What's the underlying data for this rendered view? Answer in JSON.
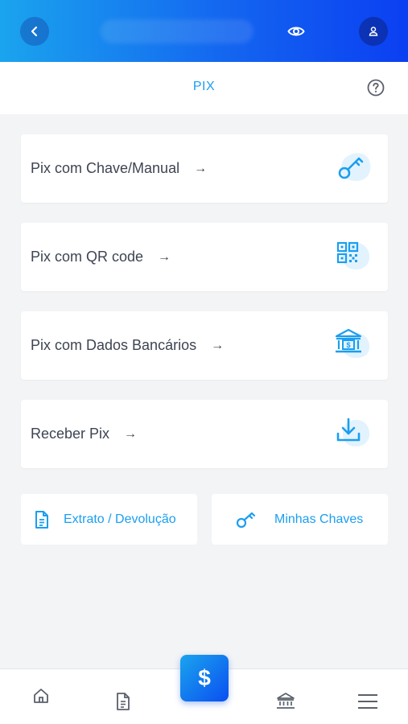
{
  "header": {
    "title": "PIX"
  },
  "cards": [
    {
      "label": "Pix com Chave/Manual",
      "arrow": "→",
      "icon": "key-icon"
    },
    {
      "label": "Pix com QR code",
      "arrow": "→",
      "icon": "qr-code-icon"
    },
    {
      "label": "Pix com Dados Bancários",
      "arrow": "→",
      "icon": "bank-icon"
    },
    {
      "label": "Receber Pix",
      "arrow": "→",
      "icon": "download-icon"
    }
  ],
  "quick": [
    {
      "label": "Extrato / Devolução",
      "icon": "document-icon"
    },
    {
      "label": "Minhas Chaves",
      "icon": "key-icon"
    }
  ],
  "fab": {
    "symbol": "$"
  },
  "colors": {
    "accent": "#1b9ef0",
    "gradient_start": "#1aa4ee",
    "gradient_end": "#0b3ff2",
    "text": "#3d4452"
  }
}
